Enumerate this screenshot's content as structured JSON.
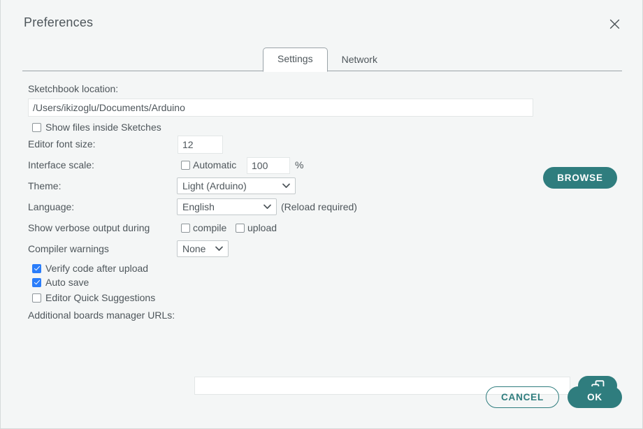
{
  "window": {
    "title": "Preferences",
    "close_icon": "close-icon"
  },
  "tabs": [
    {
      "label": "Settings",
      "active": true
    },
    {
      "label": "Network",
      "active": false
    }
  ],
  "settings": {
    "sketchbook": {
      "label": "Sketchbook location:",
      "value": "/Users/ikizoglu/Documents/Arduino",
      "browse_label": "BROWSE"
    },
    "show_files_inside_sketches": {
      "label": "Show files inside Sketches",
      "checked": false
    },
    "editor_font_size": {
      "label": "Editor font size:",
      "value": "12"
    },
    "interface_scale": {
      "label": "Interface scale:",
      "automatic_label": "Automatic",
      "automatic_checked": false,
      "value": "100",
      "unit": "%"
    },
    "theme": {
      "label": "Theme:",
      "value": "Light (Arduino)",
      "options": [
        "Light (Arduino)"
      ]
    },
    "language": {
      "label": "Language:",
      "value": "English",
      "options": [
        "English"
      ],
      "note": "(Reload required)"
    },
    "verbose_output": {
      "label": "Show verbose output during",
      "compile_label": "compile",
      "compile_checked": false,
      "upload_label": "upload",
      "upload_checked": false
    },
    "compiler_warnings": {
      "label": "Compiler warnings",
      "value": "None",
      "options": [
        "None"
      ]
    },
    "verify_code_after_upload": {
      "label": "Verify code after upload",
      "checked": true
    },
    "auto_save": {
      "label": "Auto save",
      "checked": true
    },
    "editor_quick_suggestions": {
      "label": "Editor Quick Suggestions",
      "checked": false
    },
    "additional_urls": {
      "label": "Additional boards manager URLs:",
      "value": "",
      "expand_icon": "multi-window-icon"
    }
  },
  "footer": {
    "cancel_label": "CANCEL",
    "ok_label": "OK"
  },
  "colors": {
    "accent_teal": "#2f7d7e",
    "checkbox_blue": "#2a7dfa",
    "background": "#f4f6f6",
    "text": "#4e565b"
  }
}
